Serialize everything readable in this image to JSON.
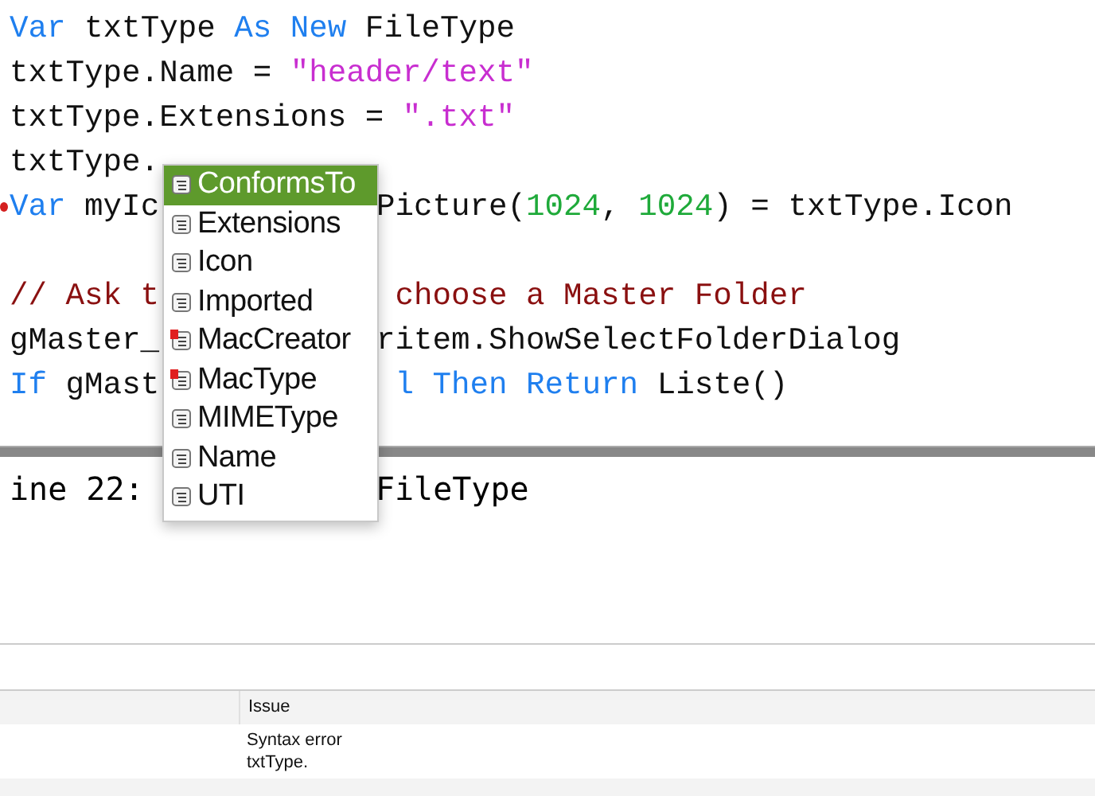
{
  "editor": {
    "lines": [
      {
        "flagged": false,
        "before": [
          {
            "kind": "keyword",
            "text": "Var"
          },
          {
            "kind": "plain",
            "text": " txtType "
          },
          {
            "kind": "keyword",
            "text": "As New"
          },
          {
            "kind": "plain",
            "text": " FileType"
          }
        ]
      },
      {
        "flagged": false,
        "before": [
          {
            "kind": "plain",
            "text": "txtType.Name = "
          },
          {
            "kind": "string",
            "text": "\"header/text\""
          }
        ]
      },
      {
        "flagged": false,
        "before": [
          {
            "kind": "plain",
            "text": "txtType.Extensions = "
          },
          {
            "kind": "string",
            "text": "\".txt\""
          }
        ]
      },
      {
        "flagged": false,
        "before": [
          {
            "kind": "plain",
            "text": "txtType."
          }
        ]
      },
      {
        "flagged": true,
        "before": [
          {
            "kind": "keyword",
            "text": "Var"
          },
          {
            "kind": "plain",
            "text": " myIc"
          }
        ],
        "after": [
          {
            "kind": "plain",
            "text": "Picture("
          },
          {
            "kind": "number",
            "text": "1024"
          },
          {
            "kind": "plain",
            "text": ", "
          },
          {
            "kind": "number",
            "text": "1024"
          },
          {
            "kind": "plain",
            "text": ") = txtType.Icon"
          }
        ]
      },
      {
        "flagged": false
      },
      {
        "flagged": false,
        "before": [
          {
            "kind": "comment",
            "text": "// Ask t"
          }
        ],
        "after": [
          {
            "kind": "comment",
            "text": " choose a Master Folder"
          }
        ]
      },
      {
        "flagged": false,
        "before": [
          {
            "kind": "plain",
            "text": "gMaster_"
          }
        ],
        "after": [
          {
            "kind": "plain",
            "text": "ritem.ShowSelectFolderDialog"
          }
        ]
      },
      {
        "flagged": false,
        "before": [
          {
            "kind": "keyword",
            "text": "If"
          },
          {
            "kind": "plain",
            "text": " gMast"
          }
        ],
        "after": [
          {
            "kind": "keyword",
            "text": " l Then Return"
          },
          {
            "kind": "plain",
            "text": " Liste()"
          }
        ]
      }
    ]
  },
  "autocomplete": {
    "items": [
      {
        "label": "ConformsTo",
        "selected": true,
        "deprecated": false
      },
      {
        "label": "Extensions",
        "selected": false,
        "deprecated": false
      },
      {
        "label": "Icon",
        "selected": false,
        "deprecated": false
      },
      {
        "label": "Imported",
        "selected": false,
        "deprecated": false
      },
      {
        "label": "MacCreator",
        "selected": false,
        "deprecated": true
      },
      {
        "label": "MacType",
        "selected": false,
        "deprecated": true
      },
      {
        "label": "MIMEType",
        "selected": false,
        "deprecated": false
      },
      {
        "label": "Name",
        "selected": false,
        "deprecated": false
      },
      {
        "label": "UTI",
        "selected": false,
        "deprecated": false
      }
    ]
  },
  "message": {
    "before": "ine 22:",
    "after": "FileType"
  },
  "issues": {
    "header": "Issue",
    "rows": [
      {
        "issue": "Syntax error\ntxtType."
      }
    ]
  }
}
